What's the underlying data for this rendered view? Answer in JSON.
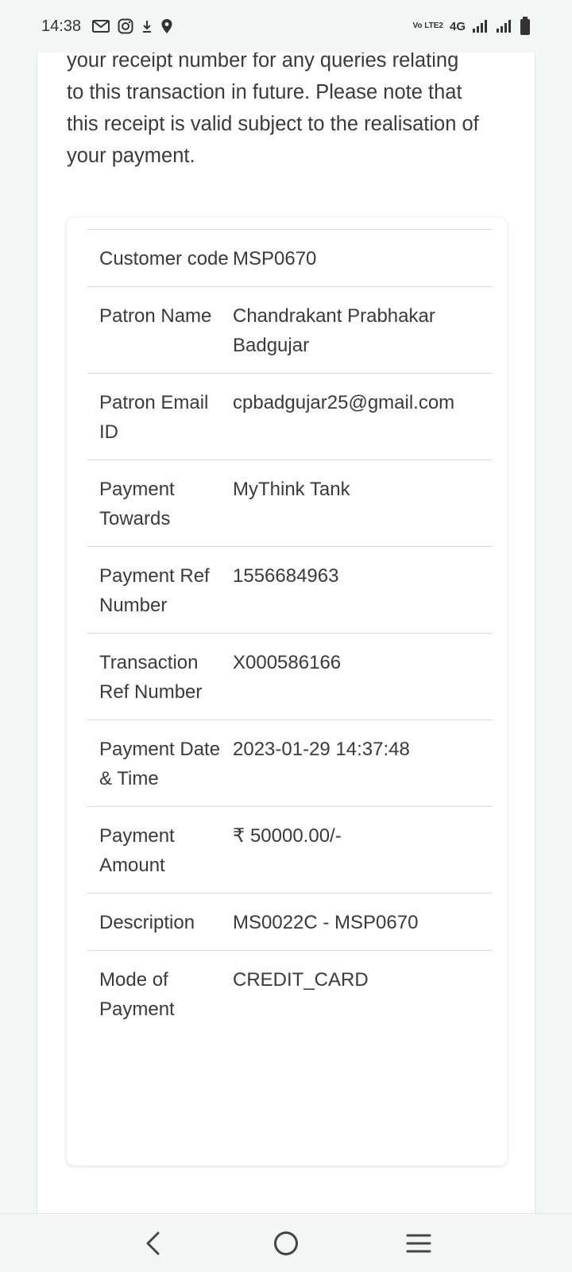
{
  "status_bar": {
    "time": "14:38",
    "icons": [
      "gmail-icon",
      "instagram-icon",
      "download-icon",
      "location-icon"
    ],
    "volte": "Vo LTE2",
    "network": "4G",
    "right_icons": [
      "signal-icon",
      "signal-icon",
      "battery-icon"
    ]
  },
  "intro": {
    "text": "your receipt number for any queries relating to this transaction in future. Please note that this receipt is valid subject to the realisation of your payment."
  },
  "receipt": {
    "rows": [
      {
        "label": "Customer code",
        "value": "MSP0670"
      },
      {
        "label": "Patron Name",
        "value": "Chandrakant Prabhakar Badgujar"
      },
      {
        "label": "Patron Email ID",
        "value": "cpbadgujar25@gmail.com"
      },
      {
        "label": "Payment Towards",
        "value": "MyThink Tank"
      },
      {
        "label": "Payment Ref Number",
        "value": "1556684963"
      },
      {
        "label": "Transaction Ref Number",
        "value": "X000586166"
      },
      {
        "label": "Payment Date & Time",
        "value": "2023-01-29 14:37:48"
      },
      {
        "label": "Payment Amount",
        "value": "₹ 50000.00/-"
      },
      {
        "label": "Description",
        "value": "MS0022C - MSP0670"
      },
      {
        "label": "Mode of Payment",
        "value": "CREDIT_CARD"
      }
    ]
  },
  "nav_bar": {
    "buttons": [
      "back-icon",
      "home-icon",
      "recents-icon"
    ]
  },
  "colors": {
    "text": "#3a3a3a",
    "background": "#f4f6f6",
    "card": "#ffffff",
    "divider": "#d8d8d8"
  }
}
